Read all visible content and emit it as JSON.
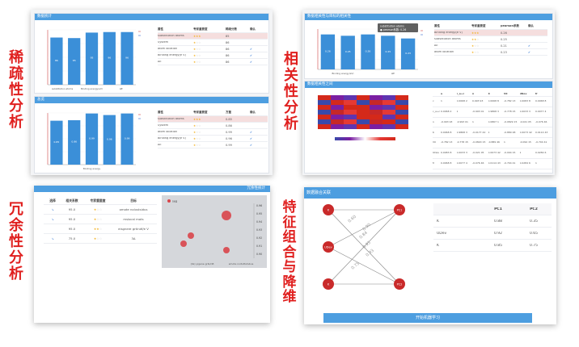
{
  "side_labels": {
    "sparsity": "稀疏性分析",
    "correlation": "相关性分析",
    "redundancy": "冗余性分析",
    "combination": "特征组合与降维"
  },
  "stars_labels": [
    "★★★",
    "★☆☆",
    "★★☆"
  ],
  "sparsity_top": {
    "header": "数据统计",
    "table": {
      "headers": [
        "属性",
        "专家重要度",
        "稀疏分数",
        "确认"
      ],
      "rows": [
        {
          "name": "substitution atoms",
          "stars": "★★★",
          "score": "85",
          "check": ""
        },
        {
          "name": "System",
          "stars": "★☆☆",
          "score": "86",
          "check": ""
        },
        {
          "name": "atom location",
          "stars": "★☆☆",
          "score": "86",
          "check": "✔"
        },
        {
          "name": "Binding energy(e V)",
          "stars": "★☆☆",
          "score": "86",
          "check": "✔"
        },
        {
          "name": "ΔE",
          "stars": "★☆☆",
          "score": "86",
          "check": "✔"
        }
      ]
    }
  },
  "sparsity_bottom": {
    "header": "总览",
    "table": {
      "headers": [
        "属性",
        "专家重要度",
        "方差",
        "确认"
      ],
      "rows": [
        {
          "name": "substitution atoms",
          "stars": "★★★",
          "score": "0.85",
          "check": ""
        },
        {
          "name": "System",
          "stars": "★☆☆",
          "score": "0.86",
          "check": ""
        },
        {
          "name": "atom location",
          "stars": "★☆☆",
          "score": "0.99",
          "check": "✔"
        },
        {
          "name": "Binding energy(e V)",
          "stars": "★☆☆",
          "score": "0.96",
          "check": "✔"
        },
        {
          "name": "ΔE",
          "stars": "★☆☆",
          "score": "0.99",
          "check": "✔"
        }
      ]
    }
  },
  "correlation_top": {
    "header": "数据相关性与目标的相关性",
    "tooltip_line1": "substitution atoms",
    "tooltip_line2": "● pearson系数: 0.26",
    "table": {
      "headers": [
        "属性",
        "专家重要度",
        "pearson系数",
        "确认"
      ],
      "rows": [
        {
          "name": "Binding energy(e V)",
          "stars": "★★★",
          "score": "0.26",
          "check": ""
        },
        {
          "name": "substitution atoms",
          "stars": "★★☆",
          "score": "0.25",
          "check": ""
        },
        {
          "name": "ΔE",
          "stars": "★☆☆",
          "score": "0.21",
          "check": "✔"
        },
        {
          "name": "atom location",
          "stars": "★☆☆",
          "score": "0.23",
          "check": "✔"
        }
      ]
    }
  },
  "correlation_bottom": {
    "header": "数据相关性之间",
    "matrix_headers": [
      "",
      "a",
      "c_a+c",
      "n",
      "K",
      "V0",
      "UDev",
      "fr"
    ],
    "matrix_rows": [
      [
        "c",
        "1",
        "0.0068 2",
        "0.993 93",
        "0.0068 8",
        "-0.782 13",
        "0.0083 8",
        "0.0068 8"
      ],
      [
        "c_a+c",
        "0.0068 2",
        "1",
        "-0.993 01",
        "0.9868 3",
        "-0.778 15",
        "0.0033 3",
        "0.0077 4"
      ],
      [
        "n",
        "-0.993 93",
        "-0.993 01",
        "1",
        "0.0867 1",
        "-0.0829 15",
        "-0.021 05",
        "-0.076 46"
      ],
      [
        "K",
        "0.0068 8",
        "0.9868 3",
        "-0.0177 42",
        "1",
        "-0.889 48",
        "0.0073 42",
        "0.0114 43"
      ],
      [
        "V0",
        "-0.782 13",
        "-0.778 15",
        "-0.0820 15",
        "-0.889 46",
        "1",
        "-0.094 15",
        "-0.704 41"
      ],
      [
        "UDev",
        "0.0083 8",
        "0.0033 3",
        "-0.021 05",
        "0.0073 42",
        "-0.094 15",
        "1",
        "0.0284 6"
      ],
      [
        "fr",
        "0.0068 8",
        "0.0077 4",
        "-0.076 46",
        "0.0114 43",
        "-0.704 41",
        "0.0284 6",
        "1"
      ]
    ]
  },
  "redundancy": {
    "header": "冗余性统计",
    "table_headers": [
      "选择",
      "相关系数",
      "专家重要度",
      "目标"
    ],
    "rows": [
      {
        "sel": "↘",
        "val": "95.0",
        "stars": "★☆☆",
        "target": "omote nolustsidus"
      },
      {
        "sel": "↘",
        "val": "95.0",
        "stars": "★☆☆",
        "target": "mslocal mots"
      },
      {
        "sel": "",
        "val": "95.0",
        "stars": "★★☆",
        "target": "eisgnere grtindf/e V"
      },
      {
        "sel": "↘",
        "val": "75.0",
        "stars": "★☆☆",
        "target": "3Δ"
      }
    ],
    "legend": "seg",
    "x_labels": [
      "(Ve) yigene grib/nB",
      "emote noituttutsbus"
    ],
    "y_ticks": [
      "0.96",
      "0.95",
      "0.94",
      "0.93",
      "0.92",
      "0.91",
      "0.90"
    ]
  },
  "combination": {
    "header": "数据融合关联",
    "left_nodes": [
      "K",
      "UDev",
      "K"
    ],
    "right_nodes": [
      "PC1",
      "PC2"
    ],
    "weights": [
      "0.60",
      "0.84",
      "0.95",
      "0.93",
      "0.75",
      "0.90"
    ],
    "table": {
      "headers": [
        "",
        "PC1",
        "PC2"
      ],
      "rows": [
        {
          "name": "K",
          "pc1": "0.88",
          "pc2": "0.35"
        },
        {
          "name": "UDev",
          "pc1": "0.92",
          "pc2": "0.65"
        },
        {
          "name": "K",
          "pc1": "0.85",
          "pc2": "0.75"
        }
      ]
    },
    "button_label": "开始机器学习"
  },
  "colors": {
    "accent": "#4d9ee0",
    "label_red": "#e0201f",
    "bar": "#3b8fd8",
    "node": "#c92a2a"
  },
  "chart_data": [
    {
      "type": "bar",
      "title": "",
      "categories": [
        "substitution atoms",
        "Binding energy(eV)",
        "ΔE"
      ],
      "values": [
        86,
        85,
        95,
        96,
        96
      ],
      "ylim": [
        0,
        100
      ],
      "xlabel": "",
      "ylabel": ""
    },
    {
      "type": "bar",
      "title": "",
      "categories": [
        "Binding energy"
      ],
      "values": [
        0.85,
        0.86,
        0.99,
        0.96,
        0.99
      ],
      "ylim": [
        0,
        1
      ],
      "xlabel": "",
      "ylabel": ""
    },
    {
      "type": "bar",
      "title": "",
      "categories": [
        "Binding energy(eV)",
        "ΔE"
      ],
      "values": [
        0.26,
        0.25,
        0.26,
        0.25,
        0.23
      ],
      "ylim": [
        0,
        0.3
      ],
      "xlabel": "",
      "ylabel": ""
    }
  ]
}
